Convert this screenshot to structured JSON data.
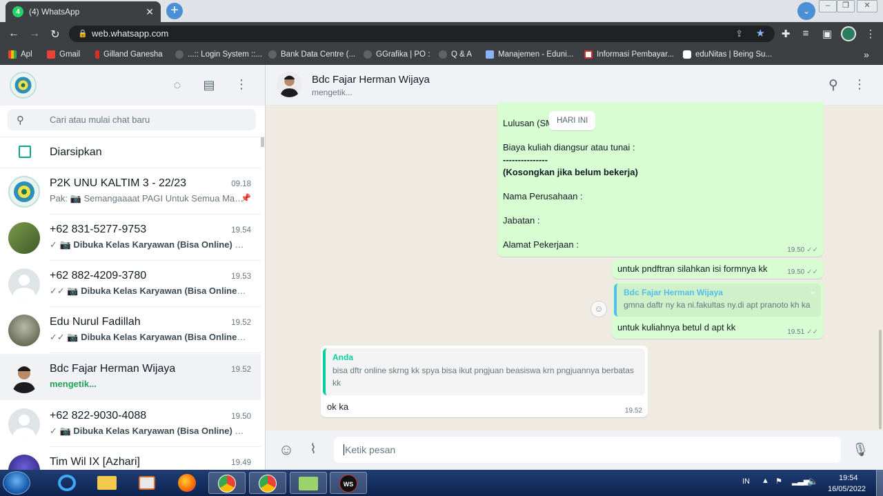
{
  "browser": {
    "tab_title": "(4) WhatsApp",
    "url": "web.whatsapp.com",
    "bookmarks": [
      "Apl",
      "Gmail",
      "Gilland Ganesha",
      "...:: Login System ::...",
      "Bank Data Centre (...",
      "GGrafika | PO :",
      "Q & A",
      "Manajemen - Eduni...",
      "Informasi Pembayar...",
      "eduNitas | Being Su..."
    ]
  },
  "sidebar": {
    "search_placeholder": "Cari atau mulai chat baru",
    "archived_label": "Diarsipkan",
    "chats": [
      {
        "name": "P2K UNU KALTIM 3 - 22/23",
        "time": "09.18",
        "prefix": "Pak: ",
        "preview": "Semangaaaat PAGI Untuk Semua Mah...",
        "pinned": true
      },
      {
        "name": "+62 831-5277-9753",
        "time": "19.54",
        "preview": "Dibuka Kelas Karyawan (Bisa Online) U..."
      },
      {
        "name": "+62 882-4209-3780",
        "time": "19.53",
        "preview": "Dibuka Kelas Karyawan (Bisa Online) U..."
      },
      {
        "name": "Edu Nurul Fadillah",
        "time": "19.52",
        "preview": "Dibuka Kelas Karyawan (Bisa Online) U..."
      },
      {
        "name": "Bdc Fajar Herman Wijaya",
        "time": "19.52",
        "preview": "mengetik..."
      },
      {
        "name": "+62 822-9030-4088",
        "time": "19.50",
        "preview": "Dibuka Kelas Karyawan (Bisa Online) U..."
      },
      {
        "name": "Tim Wil IX [Azhari]",
        "time": "19.49",
        "preview": ""
      }
    ]
  },
  "conversation": {
    "contact_name": "Bdc Fajar Herman Wijaya",
    "status": "mengetik...",
    "date_chip": "HARI INI",
    "form_message": {
      "line1": "Lulusan (SM",
      "line2": "Biaya kuliah diangsur atau tunai :",
      "line3": "---------------",
      "line4": "(Kosongkan jika belum bekerja)",
      "line5": "Nama Perusahaan :",
      "line6": "Jabatan :",
      "line7": "Alamat Pekerjaan :",
      "time": "19.50"
    },
    "msg_daftar": {
      "text": "untuk pndftran silahkan isi formnya kk",
      "time": "19.50"
    },
    "msg_reply_out": {
      "quote_name": "Bdc Fajar Herman Wijaya",
      "quote_text": "gmna daftr ny ka ni.fakultas ny.di apt pranoto kh ka",
      "text": "untuk kuliahnya betul d apt kk",
      "time": "19.51"
    },
    "msg_reply_in": {
      "quote_name": "Anda",
      "quote_text": "bisa dftr online skrng kk spya bisa ikut pngjuan beasiswa krn pngjuannya berbatas kk",
      "text": "ok ka",
      "time": "19.52"
    },
    "input_placeholder": "Ketik pesan"
  },
  "taskbar": {
    "lang": "IN",
    "time": "19:54",
    "date": "16/05/2022"
  },
  "colors": {
    "accent": "#00a884",
    "outgoing_bubble": "#d9fdd3",
    "chat_bg": "#efeae2"
  }
}
